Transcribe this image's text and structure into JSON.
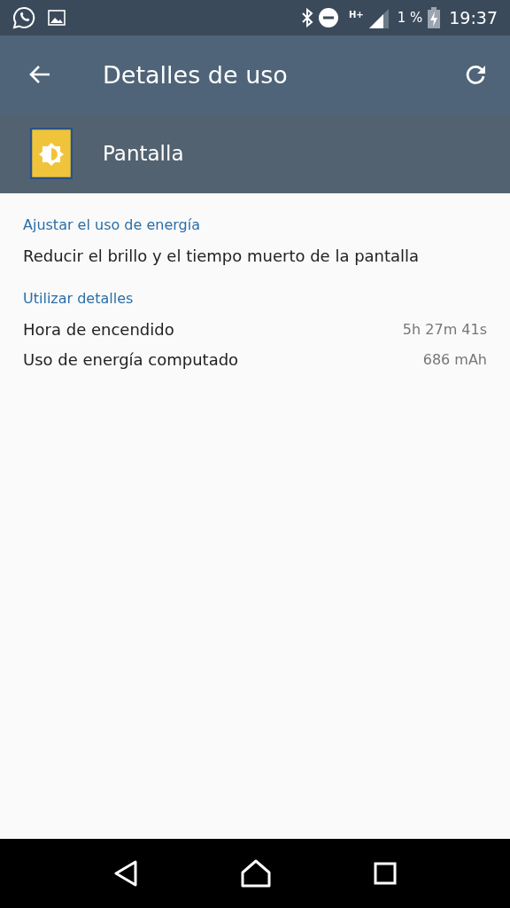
{
  "status_bar": {
    "network": "H+",
    "battery": "1 %",
    "time": "19:37"
  },
  "toolbar": {
    "title": "Detalles de uso"
  },
  "app_header": {
    "name": "Pantalla"
  },
  "sections": [
    {
      "heading": "Ajustar el uso de energía",
      "rows": [
        {
          "label": "Reducir el brillo y el tiempo muerto de la pantalla"
        }
      ]
    },
    {
      "heading": "Utilizar detalles",
      "rows": [
        {
          "label": "Hora de encendido",
          "value": "5h 27m 41s"
        },
        {
          "label": "Uso de energía computado",
          "value": "686 mAh"
        }
      ]
    }
  ]
}
